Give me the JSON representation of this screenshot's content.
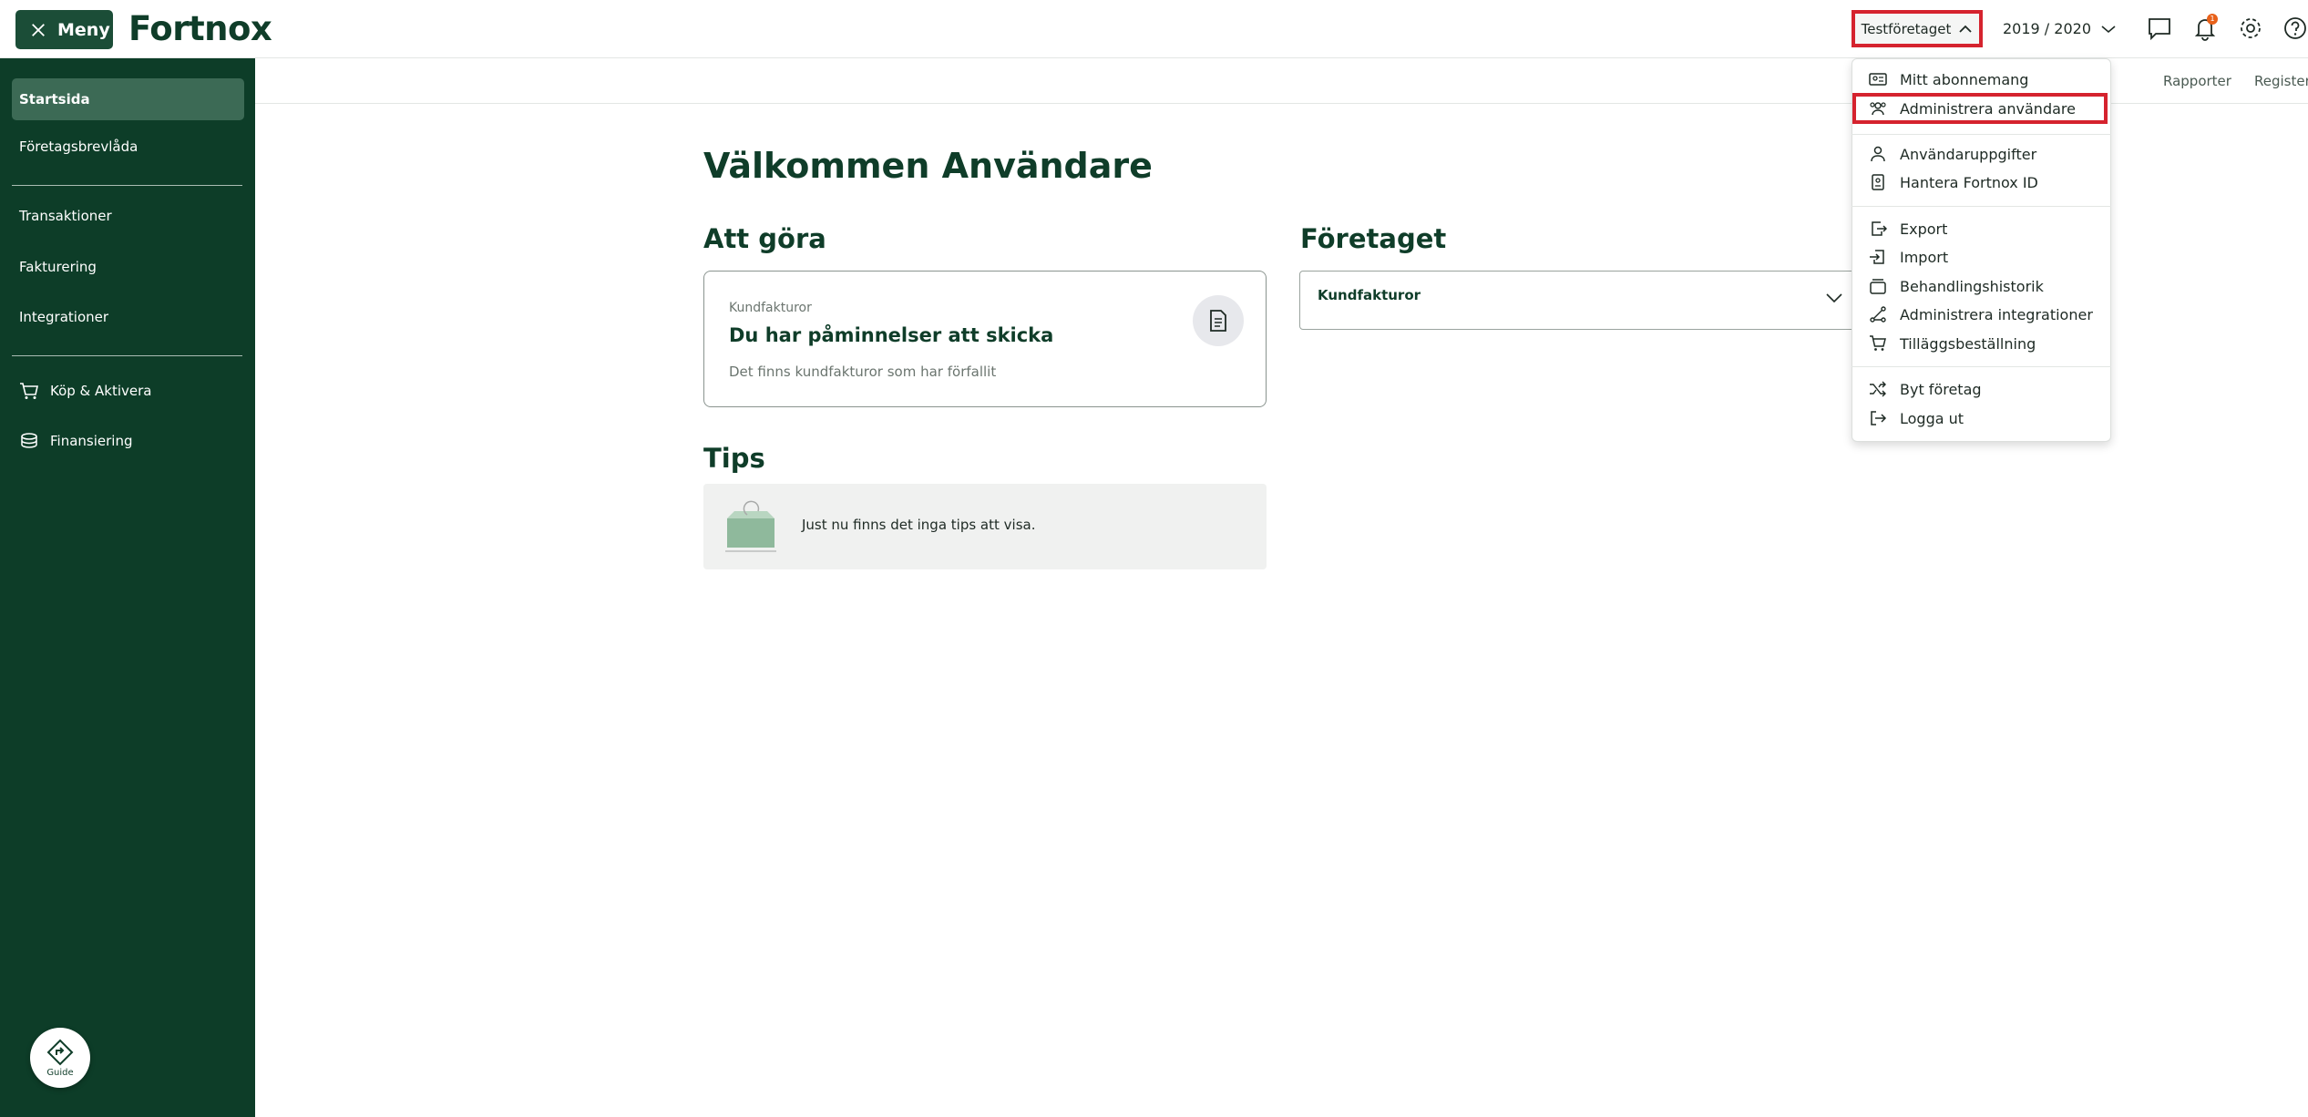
{
  "topbar": {
    "menu_label": "Meny",
    "logo_text": "Fortnox",
    "company_label": "Testföretaget",
    "year_label": "2019 / 2020",
    "notification_count": "1"
  },
  "subnav": {
    "links": [
      "Rapporter",
      "Register"
    ]
  },
  "sidebar": {
    "items": [
      {
        "label": "Startsida"
      },
      {
        "label": "Företagsbrevlåda"
      },
      {
        "label": "Transaktioner"
      },
      {
        "label": "Fakturering"
      },
      {
        "label": "Integrationer"
      },
      {
        "label": "Köp & Aktivera"
      },
      {
        "label": "Finansiering"
      }
    ],
    "guide_label": "Guide"
  },
  "main": {
    "welcome": "Välkommen Användare",
    "todo": {
      "heading": "Att göra",
      "card_sub": "Kundfakturor",
      "card_title": "Du har påminnelser att skicka",
      "card_desc": "Det finns kundfakturor som har förfallit"
    },
    "company": {
      "heading": "Företaget",
      "card_label": "Kundfakturor"
    },
    "tips": {
      "heading": "Tips",
      "text": "Just nu finns det inga tips att visa."
    }
  },
  "dropdown": {
    "items": [
      {
        "label": "Mitt abonnemang",
        "icon": "id-card-icon"
      },
      {
        "label": "Administrera användare",
        "icon": "users-icon"
      },
      {
        "label": "Användaruppgifter",
        "icon": "user-icon"
      },
      {
        "label": "Hantera Fortnox ID",
        "icon": "id-badge-icon"
      },
      {
        "label": "Export",
        "icon": "export-icon"
      },
      {
        "label": "Import",
        "icon": "import-icon"
      },
      {
        "label": "Behandlingshistorik",
        "icon": "history-icon"
      },
      {
        "label": "Administrera integrationer",
        "icon": "integrations-icon"
      },
      {
        "label": "Tilläggsbeställning",
        "icon": "cart-icon"
      },
      {
        "label": "Byt företag",
        "icon": "shuffle-icon"
      },
      {
        "label": "Logga ut",
        "icon": "logout-icon"
      }
    ]
  },
  "colors": {
    "sidebar_bg": "#0d3d28",
    "brand_dark": "#0f3d29",
    "highlight": "#d5232e",
    "badge": "#e8611a"
  }
}
